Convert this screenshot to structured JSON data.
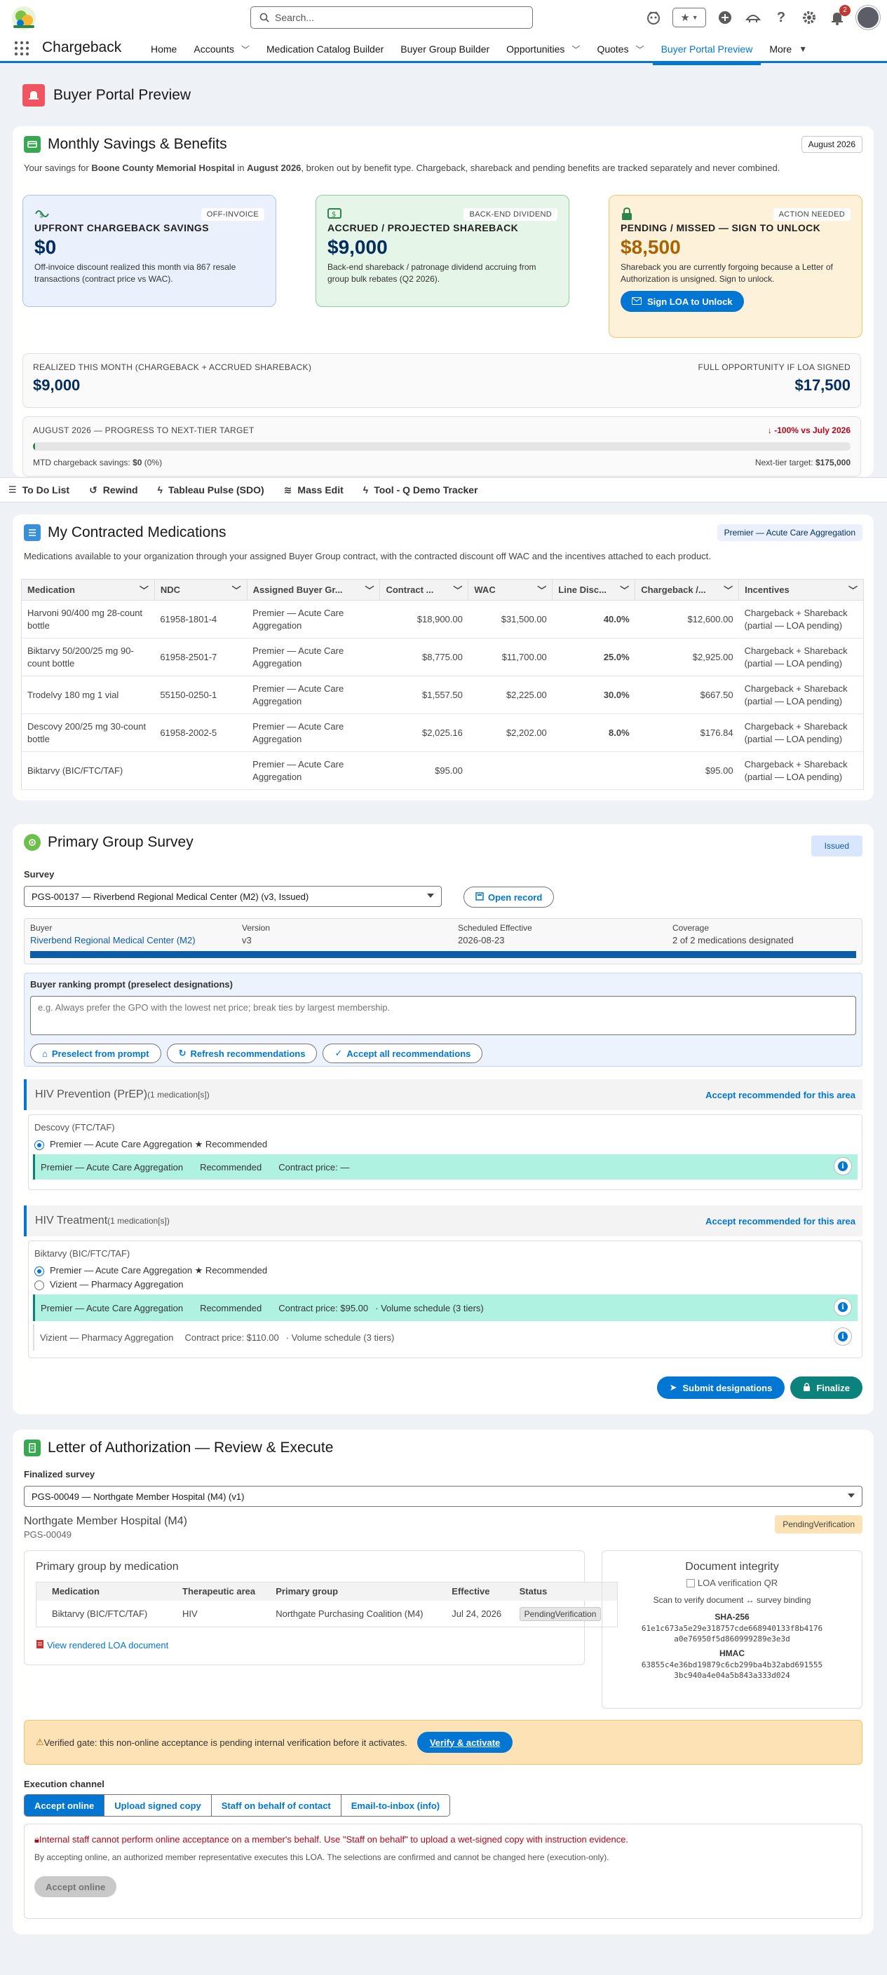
{
  "header": {
    "search_placeholder": "Search...",
    "notification_count": "2"
  },
  "appbar": {
    "app_name": "Chargeback",
    "nav": [
      {
        "label": "Home",
        "menu": false
      },
      {
        "label": "Accounts",
        "menu": true
      },
      {
        "label": "Medication Catalog Builder",
        "menu": false
      },
      {
        "label": "Buyer Group Builder",
        "menu": false
      },
      {
        "label": "Opportunities",
        "menu": true
      },
      {
        "label": "Quotes",
        "menu": true
      },
      {
        "label": "Buyer Portal Preview",
        "menu": false,
        "active": true
      },
      {
        "label": "More",
        "menu": true
      }
    ]
  },
  "page": {
    "title": "Buyer Portal Preview"
  },
  "savings": {
    "title": "Monthly Savings & Benefits",
    "period": "August 2026",
    "desc_prefix": "Your savings for ",
    "desc_org": "Boone County Memorial Hospital",
    "desc_in": " in ",
    "desc_month": "August 2026",
    "desc_suffix": ", broken out by benefit type. Chargeback, shareback and pending benefits are tracked separately and never combined.",
    "upfront": {
      "tag": "OFF-INVOICE",
      "head": "UPFRONT CHARGEBACK SAVINGS",
      "value": "$0",
      "desc": "Off-invoice discount realized this month via 867 resale transactions (contract price vs WAC)."
    },
    "accrued": {
      "tag": "BACK-END DIVIDEND",
      "head": "ACCRUED / PROJECTED SHAREBACK",
      "value": "$9,000",
      "desc": "Back-end shareback / patronage dividend accruing from group bulk rebates (Q2 2026)."
    },
    "pending": {
      "tag": "ACTION NEEDED",
      "head": "PENDING / MISSED — SIGN TO UNLOCK",
      "value": "$8,500",
      "desc": "Shareback you are currently forgoing because a Letter of Authorization is unsigned. Sign to unlock.",
      "button": "Sign LOA to Unlock"
    },
    "realized_label": "REALIZED THIS MONTH (CHARGEBACK + ACCRUED SHAREBACK)",
    "realized_value": "$9,000",
    "full_label": "FULL OPPORTUNITY IF LOA SIGNED",
    "full_value": "$17,500",
    "progress_label": "AUGUST 2026 — PROGRESS TO NEXT-TIER TARGET",
    "progress_delta": "-100% vs July 2026",
    "progress_fraction": 0.0,
    "mtd_label": "MTD chargeback savings: ",
    "mtd_value": "$0",
    "mtd_pct": " (0%)",
    "next_tier_label": "Next-tier target: ",
    "next_tier_value": "$175,000"
  },
  "utility": [
    {
      "label": "To Do List",
      "icon": "list-icon"
    },
    {
      "label": "Rewind",
      "icon": "rewind-icon"
    },
    {
      "label": "Tableau Pulse (SDO)",
      "icon": "bolt-icon"
    },
    {
      "label": "Mass Edit",
      "icon": "stack-icon"
    },
    {
      "label": "Tool - Q Demo Tracker",
      "icon": "bolt-icon"
    }
  ],
  "meds": {
    "title": "My Contracted Medications",
    "group_pill": "Premier — Acute Care Aggregation",
    "desc": "Medications available to your organization through your assigned Buyer Group contract, with the contracted discount off WAC and the incentives attached to each product.",
    "columns": [
      "Medication",
      "NDC",
      "Assigned Buyer Gr...",
      "Contract ...",
      "WAC",
      "Line Disc...",
      "Chargeback /...",
      "Incentives"
    ],
    "rows": [
      {
        "med": "Harvoni 90/400 mg 28-count bottle",
        "ndc": "61958-1801-4",
        "group": "Premier — Acute Care Aggregation",
        "contract": "$18,900.00",
        "wac": "$31,500.00",
        "disc": "40.0%",
        "cb": "$12,600.00",
        "inc": "Chargeback + Shareback (partial — LOA pending)"
      },
      {
        "med": "Biktarvy 50/200/25 mg 90-count bottle",
        "ndc": "61958-2501-7",
        "group": "Premier — Acute Care Aggregation",
        "contract": "$8,775.00",
        "wac": "$11,700.00",
        "disc": "25.0%",
        "cb": "$2,925.00",
        "inc": "Chargeback + Shareback (partial — LOA pending)"
      },
      {
        "med": "Trodelvy 180 mg 1 vial",
        "ndc": "55150-0250-1",
        "group": "Premier — Acute Care Aggregation",
        "contract": "$1,557.50",
        "wac": "$2,225.00",
        "disc": "30.0%",
        "cb": "$667.50",
        "inc": "Chargeback + Shareback (partial — LOA pending)"
      },
      {
        "med": "Descovy 200/25 mg 30-count bottle",
        "ndc": "61958-2002-5",
        "group": "Premier — Acute Care Aggregation",
        "contract": "$2,025.16",
        "wac": "$2,202.00",
        "disc": "8.0%",
        "cb": "$176.84",
        "inc": "Chargeback + Shareback (partial — LOA pending)"
      },
      {
        "med": "Biktarvy (BIC/FTC/TAF)",
        "ndc": "",
        "group": "Premier — Acute Care Aggregation",
        "contract": "$95.00",
        "wac": "",
        "disc": "",
        "cb": "$95.00",
        "inc": "Chargeback + Shareback (partial — LOA pending)"
      }
    ]
  },
  "survey": {
    "title": "Primary Group Survey",
    "status": "Issued",
    "survey_label": "Survey",
    "survey_value": "PGS-00137 — Riverbend Regional Medical Center (M2) (v3, Issued)",
    "open_record": "Open record",
    "buyer_label": "Buyer",
    "buyer_value": "Riverbend Regional Medical Center (M2)",
    "version_label": "Version",
    "version_value": "v3",
    "sched_label": "Scheduled Effective",
    "sched_value": "2026-08-23",
    "coverage_label": "Coverage",
    "coverage_value": "2 of 2 medications designated",
    "coverage_fraction": 1.0,
    "prompt_label": "Buyer ranking prompt (preselect designations)",
    "prompt_placeholder": "e.g. Always prefer the GPO with the lowest net price; break ties by largest membership.",
    "btn_preselect": "Preselect from prompt",
    "btn_refresh": "Refresh recommendations",
    "btn_accept_all": "Accept all recommendations",
    "accept_area": "Accept recommended for this area",
    "area1": {
      "name": "HIV Prevention (PrEP)",
      "count": "(1 medication[s])",
      "med": "Descovy (FTC/TAF)",
      "opt1": "Premier — Acute Care Aggregation ★ Recommended",
      "rec_group": "Premier — Acute Care Aggregation",
      "rec_tag": "Recommended",
      "rec_price": "Contract price: —"
    },
    "area2": {
      "name": "HIV Treatment",
      "count": "(1 medication[s])",
      "med": "Biktarvy (BIC/FTC/TAF)",
      "opt1": "Premier — Acute Care Aggregation ★ Recommended",
      "opt2": "Vizient — Pharmacy Aggregation",
      "rec_group": "Premier — Acute Care Aggregation",
      "rec_tag": "Recommended",
      "rec_price": "Contract price: $95.00",
      "rec_sched": "· Volume schedule (3 tiers)",
      "alt_group": "Vizient — Pharmacy Aggregation",
      "alt_price": "Contract price: $110.00",
      "alt_sched": "· Volume schedule (3 tiers)"
    },
    "btn_submit": "Submit designations",
    "btn_finalize": "Finalize"
  },
  "loa": {
    "title": "Letter of Authorization — Review & Execute",
    "final_label": "Finalized survey",
    "final_value": "PGS-00049 — Northgate Member Hospital (M4) (v1)",
    "hospital": "Northgate Member Hospital (M4)",
    "pgs": "PGS-00049",
    "status": "PendingVerification",
    "pg_title": "Primary group by medication",
    "pg_cols": [
      "Medication",
      "Therapeutic area",
      "Primary group",
      "Effective",
      "Status"
    ],
    "pg_row": {
      "med": "Biktarvy (BIC/FTC/TAF)",
      "area": "HIV",
      "group": "Northgate Purchasing Coalition (M4)",
      "eff": "Jul 24, 2026",
      "status": "PendingVerification"
    },
    "view_doc": "View rendered LOA document",
    "integrity_title": "Document integrity",
    "qr_alt": "LOA verification QR",
    "scan_text": "Scan to verify document ↔ survey binding",
    "sha_label": "SHA-256",
    "sha_value": "61e1c673a5e29e318757cde668940133f8b4176a0e76950f5d860999289e3e3d",
    "hmac_label": "HMAC",
    "hmac_value": "63855c4e36bd19879c6cb299ba4b32abd6915553bc940a4e04a5b843a333d024",
    "gate_text": "Verified gate: this non-online acceptance is pending internal verification before it activates.",
    "gate_btn": "Verify & activate",
    "exec_label": "Execution channel",
    "channels": [
      "Accept online",
      "Upload signed copy",
      "Staff on behalf of contact",
      "Email-to-inbox (info)"
    ],
    "warn": "Internal staff cannot perform online acceptance on a member's behalf. Use \"Staff on behalf\" to upload a wet-signed copy with instruction evidence.",
    "note": "By accepting online, an authorized member representative executes this LOA. The selections are confirmed and cannot be changed here (execution-only).",
    "accept_btn": "Accept online"
  },
  "colors": {
    "brand": "#0176d3",
    "success": "#2e844a",
    "warning": "#a86403",
    "danger": "#c23934"
  }
}
